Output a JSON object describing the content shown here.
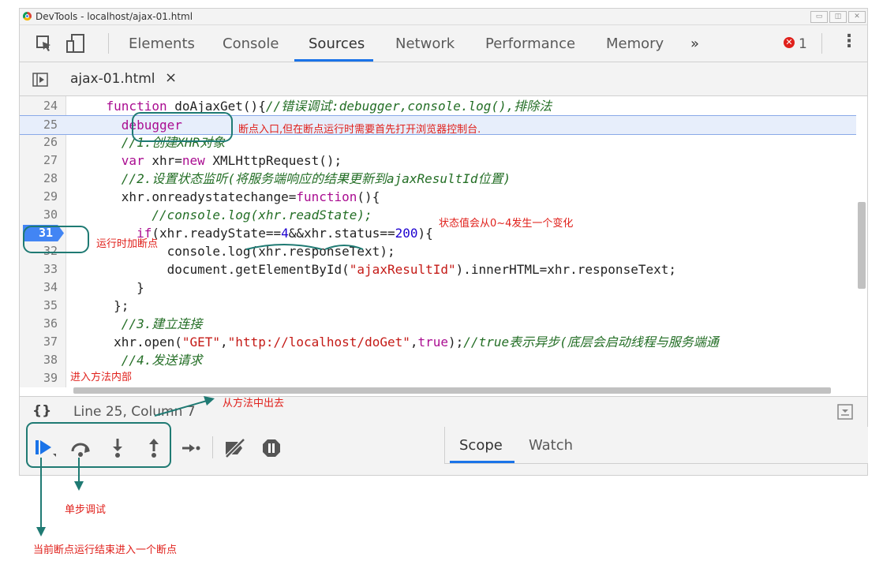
{
  "window": {
    "title": "DevTools - localhost/ajax-01.html"
  },
  "toolbar": {
    "tabs": [
      {
        "label": "Elements"
      },
      {
        "label": "Console"
      },
      {
        "label": "Sources"
      },
      {
        "label": "Network"
      },
      {
        "label": "Performance"
      },
      {
        "label": "Memory"
      }
    ],
    "more": "»",
    "error_count": "1"
  },
  "file_tab": {
    "name": "ajax-01.html",
    "close": "×"
  },
  "code": {
    "lines": [
      {
        "n": "24"
      },
      {
        "n": "25"
      },
      {
        "n": "26"
      },
      {
        "n": "27"
      },
      {
        "n": "28"
      },
      {
        "n": "29"
      },
      {
        "n": "30"
      },
      {
        "n": "31"
      },
      {
        "n": "32"
      },
      {
        "n": "33"
      },
      {
        "n": "34"
      },
      {
        "n": "35"
      },
      {
        "n": "36"
      },
      {
        "n": "37"
      },
      {
        "n": "38"
      },
      {
        "n": "39"
      }
    ],
    "breakpoint_line": "31"
  },
  "status": {
    "position": "Line 25, Column 7",
    "braces": "{}"
  },
  "pane_tabs": [
    {
      "label": "Scope"
    },
    {
      "label": "Watch"
    }
  ],
  "annotations": {
    "breakpoint_entry": "断点入口,但在断点运行时需要首先打开浏览器控制台.",
    "state_change": "状态值会从0~4发生一个变化",
    "runtime_breakpoint": "运行时加断点",
    "step_into": "进入方法内部",
    "step_out": "从方法中出去",
    "step_over": "单步调试",
    "resume": "当前断点运行结束进入一个断点"
  },
  "colors": {
    "accent": "#1a73e8",
    "breakpoint": "#4285f4",
    "annotation_text": "#e0201b",
    "annotation_mark": "#1f7a73"
  }
}
